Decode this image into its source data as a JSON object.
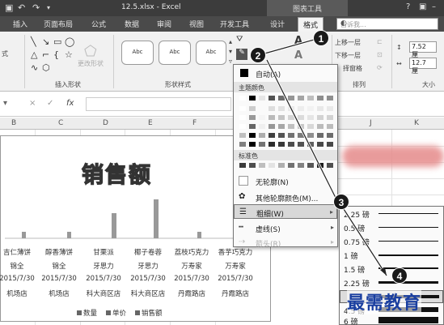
{
  "titlebar": {
    "file_title": "12.5.xlsx - Excel",
    "context_tools": "图表工具",
    "help": "?",
    "undo_icon": "undo-icon"
  },
  "tabs": [
    "插入",
    "页面布局",
    "公式",
    "数据",
    "审阅",
    "视图",
    "开发工具",
    "设计",
    "格式"
  ],
  "active_tab": "格式",
  "search": {
    "placeholder": "告诉我..."
  },
  "ribbon": {
    "left_fragment": "式",
    "change_shape_label": "更改形状",
    "insert_shapes_label": "插入形状",
    "shape_styles_label": "形状样式",
    "style_button_text": "Abc",
    "bring_forward": "上移一层",
    "send_backward": "下移一层",
    "selection_pane": "择窗格",
    "arrange_label": "排列",
    "size_label": "大小",
    "height_value": "7.52 厘",
    "width_value": "12.7 厘"
  },
  "formula_bar": {
    "cancel": "×",
    "enter": "✓",
    "fx": "fx"
  },
  "columns": [
    "B",
    "C",
    "D",
    "E",
    "F",
    "J",
    "K"
  ],
  "chart": {
    "title": "销售额",
    "categories": [
      {
        "name": "吉仁薄饼",
        "line2": "锦全",
        "date": "2015/7/30",
        "store": "机场店"
      },
      {
        "name": "醇香薄饼",
        "line2": "锦全",
        "date": "2015/7/30",
        "store": "机场店"
      },
      {
        "name": "甘栗派",
        "line2": "牙思力",
        "date": "2015/7/30",
        "store": "科大商区店"
      },
      {
        "name": "椰子卷蓉",
        "line2": "牙思力",
        "date": "2015/7/30",
        "store": "科大商区店"
      },
      {
        "name": "荔枝巧克力",
        "line2": "万寿家",
        "date": "2015/7/30",
        "store": "丹霞路店"
      },
      {
        "name": "香芋巧克力",
        "line2": "万寿家",
        "date": "2015/7/30",
        "store": "丹霞路店"
      }
    ],
    "legend": [
      "数量",
      "单价",
      "销售额"
    ]
  },
  "outline_menu": {
    "auto": "自动(A)",
    "theme_colors": "主题颜色",
    "standard_colors": "标准色",
    "no_outline": "无轮廓(N)",
    "more_colors": "其他轮廓颜色(M)...",
    "weight": "粗细(W)",
    "dashes": "虚线(S)",
    "arrows": "箭头(R)"
  },
  "weights": [
    "2.25 磅",
    "0.5 磅",
    "0.75 磅",
    "1 磅",
    "1.5 磅",
    "2.25 磅",
    "",
    "4.5 磅",
    "6 磅"
  ],
  "badges": [
    "1",
    "2",
    "3",
    "4"
  ],
  "watermark": "最需教育",
  "colors": {
    "theme_row_top": [
      "#ffffff",
      "#000000",
      "#e7e6e6",
      "#44546a",
      "#4472c4",
      "#ed7d31",
      "#a5a5a5",
      "#ffc000",
      "#5b9bd5",
      "#70ad47"
    ],
    "standard": [
      "#c00000",
      "#ff0000",
      "#ffc000",
      "#ffff00",
      "#92d050",
      "#00b050",
      "#00b0f0",
      "#0070c0",
      "#002060",
      "#7030a0"
    ]
  }
}
